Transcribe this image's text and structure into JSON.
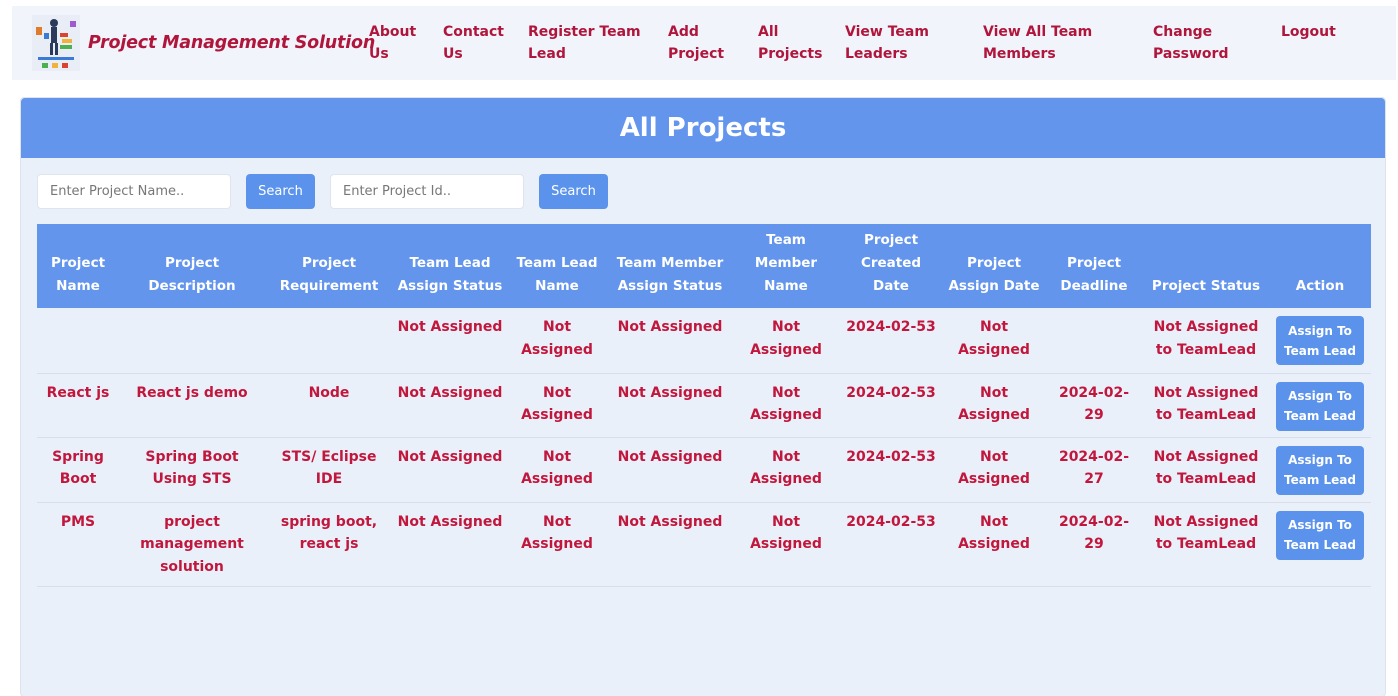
{
  "brand": {
    "name": "Project Management Solution"
  },
  "nav": [
    {
      "line1": "About",
      "line2": "Us"
    },
    {
      "line1": "Contact",
      "line2": "Us"
    },
    {
      "line1": "Register Team",
      "line2": "Lead"
    },
    {
      "line1": "Add",
      "line2": "Project"
    },
    {
      "line1": "All",
      "line2": "Projects"
    },
    {
      "line1": "View Team",
      "line2": "Leaders"
    },
    {
      "line1": "View All Team",
      "line2": "Members"
    },
    {
      "line1": "Change",
      "line2": "Password"
    },
    {
      "line1": "Logout",
      "line2": ""
    }
  ],
  "page": {
    "title": "All Projects"
  },
  "search": {
    "name_placeholder": "Enter Project Name..",
    "id_placeholder": "Enter Project Id..",
    "button_label": "Search"
  },
  "table": {
    "headers": [
      [
        "Project",
        "Name"
      ],
      [
        "Project",
        "Description"
      ],
      [
        "Project",
        "Requirement"
      ],
      [
        "Team Lead",
        "Assign Status"
      ],
      [
        "Team Lead",
        "Name"
      ],
      [
        "Team Member",
        "Assign Status"
      ],
      [
        "Team",
        "Member",
        "Name"
      ],
      [
        "Project",
        "Created",
        "Date"
      ],
      [
        "Project",
        "Assign Date"
      ],
      [
        "Project",
        "Deadline"
      ],
      [
        "Project Status"
      ],
      [
        "Action"
      ]
    ],
    "rows": [
      {
        "name": "",
        "description": "",
        "requirement": "",
        "lead_status": "Not Assigned",
        "lead_name": [
          "Not",
          "Assigned"
        ],
        "member_status": "Not Assigned",
        "member_name": [
          "Not",
          "Assigned"
        ],
        "created": "2024-02-53",
        "assign_date": [
          "Not",
          "Assigned"
        ],
        "deadline": [
          "",
          ""
        ],
        "status": [
          "Not Assigned",
          "to TeamLead"
        ],
        "action": [
          "Assign To",
          "Team Lead"
        ]
      },
      {
        "name": "React js",
        "description": "React js demo",
        "requirement": "Node",
        "lead_status": "Not Assigned",
        "lead_name": [
          "Not",
          "Assigned"
        ],
        "member_status": "Not Assigned",
        "member_name": [
          "Not",
          "Assigned"
        ],
        "created": "2024-02-53",
        "assign_date": [
          "Not",
          "Assigned"
        ],
        "deadline": [
          "2024-02-",
          "29"
        ],
        "status": [
          "Not Assigned",
          "to TeamLead"
        ],
        "action": [
          "Assign To",
          "Team Lead"
        ]
      },
      {
        "name": "Spring Boot",
        "description": "Spring Boot Using STS",
        "requirement": "STS/ Eclipse IDE",
        "lead_status": "Not Assigned",
        "lead_name": [
          "Not",
          "Assigned"
        ],
        "member_status": "Not Assigned",
        "member_name": [
          "Not",
          "Assigned"
        ],
        "created": "2024-02-53",
        "assign_date": [
          "Not",
          "Assigned"
        ],
        "deadline": [
          "2024-02-",
          "27"
        ],
        "status": [
          "Not Assigned",
          "to TeamLead"
        ],
        "action": [
          "Assign To",
          "Team Lead"
        ]
      },
      {
        "name": "PMS",
        "description": "project management solution",
        "requirement": "spring boot, react js",
        "lead_status": "Not Assigned",
        "lead_name": [
          "Not",
          "Assigned"
        ],
        "member_status": "Not Assigned",
        "member_name": [
          "Not",
          "Assigned"
        ],
        "created": "2024-02-53",
        "assign_date": [
          "Not",
          "Assigned"
        ],
        "deadline": [
          "2024-02-",
          "29"
        ],
        "status": [
          "Not Assigned",
          "to TeamLead"
        ],
        "action": [
          "Assign To",
          "Team Lead"
        ]
      }
    ]
  },
  "icons": {
    "logo": "project-management-logo"
  },
  "colors": {
    "accent": "#6495ed",
    "text_accent": "#c2173c",
    "nav_bg": "#f1f4fb"
  }
}
